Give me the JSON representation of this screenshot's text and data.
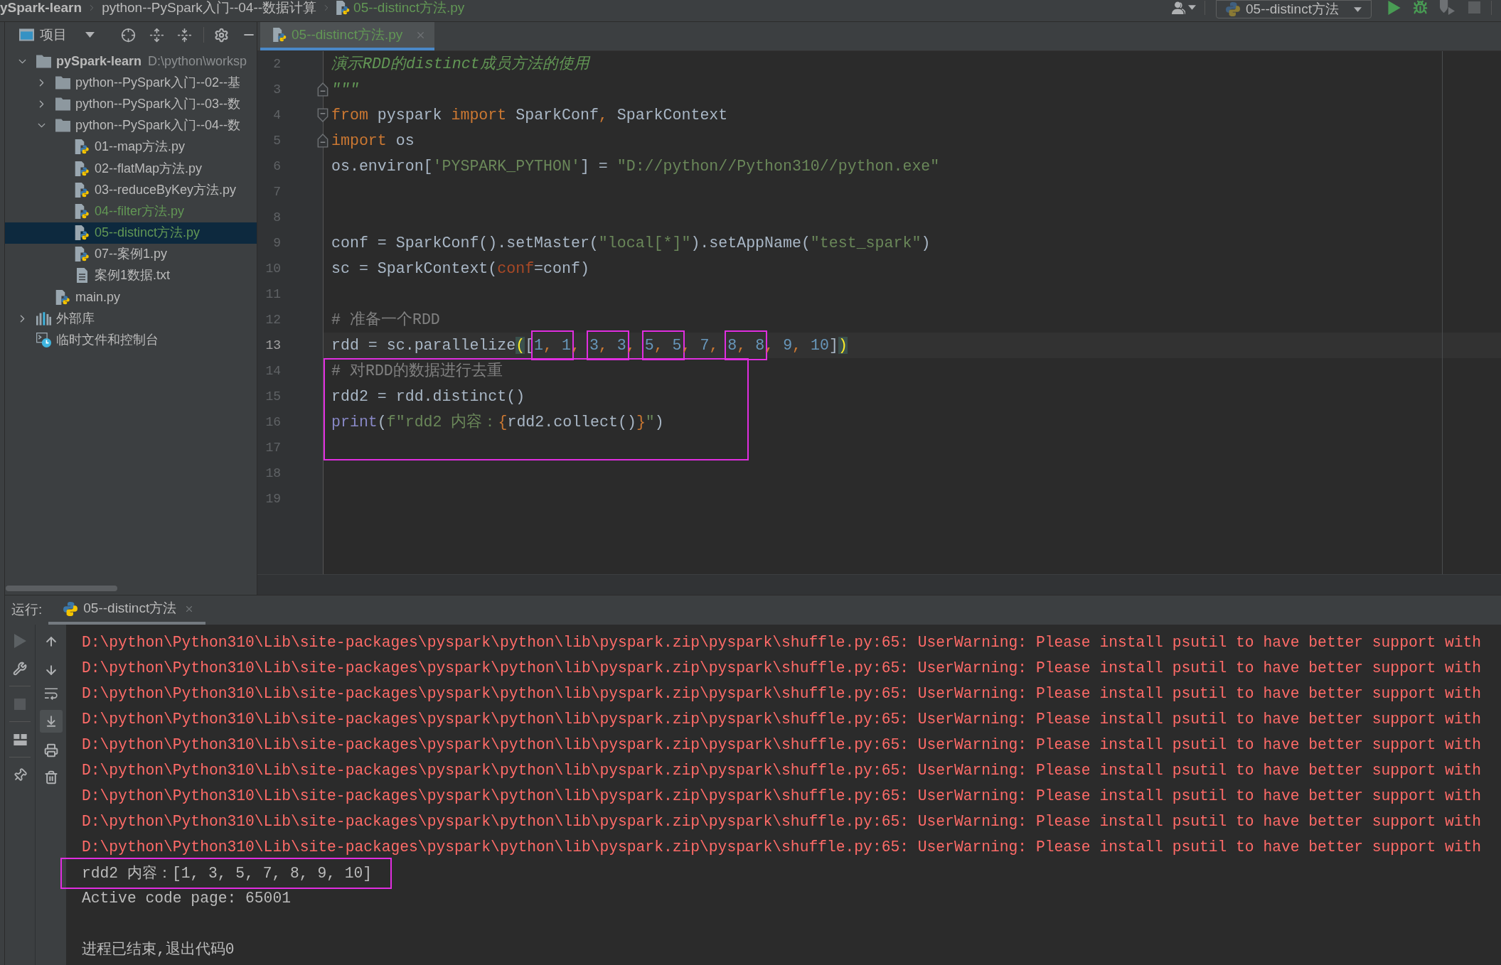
{
  "breadcrumb": [
    {
      "label": "ySpark-learn",
      "kind": "project",
      "changed": false
    },
    {
      "label": "python--PySpark入门--04--数据计算",
      "kind": "folder",
      "changed": false
    },
    {
      "label": "05--distinct方法.py",
      "kind": "python_file",
      "changed": true
    }
  ],
  "toolbar": {
    "run_config": "05--distinct方法",
    "run": {
      "disabled": false
    },
    "debug": {
      "disabled": false
    },
    "coverage": {
      "disabled": true
    },
    "stop": {
      "disabled": true
    }
  },
  "project_panel": {
    "title": "项目",
    "tree": [
      {
        "label": "pySpark-learn",
        "path": "D:\\python\\worksp",
        "kind": "project",
        "expanded": true,
        "selected": false,
        "changed": false,
        "children": [
          {
            "label": "python--PySpark入门--02--基",
            "kind": "folder",
            "expanded": false,
            "selected": false,
            "changed": false
          },
          {
            "label": "python--PySpark入门--03--数",
            "kind": "folder",
            "expanded": false,
            "selected": false,
            "changed": false
          },
          {
            "label": "python--PySpark入门--04--数",
            "kind": "folder",
            "expanded": true,
            "selected": false,
            "changed": false,
            "children": [
              {
                "label": "01--map方法.py",
                "kind": "python",
                "selected": false,
                "changed": false
              },
              {
                "label": "02--flatMap方法.py",
                "kind": "python",
                "selected": false,
                "changed": false
              },
              {
                "label": "03--reduceByKey方法.py",
                "kind": "python",
                "selected": false,
                "changed": false
              },
              {
                "label": "04--filter方法.py",
                "kind": "python",
                "selected": false,
                "changed": true
              },
              {
                "label": "05--distinct方法.py",
                "kind": "python",
                "selected": true,
                "changed": true
              },
              {
                "label": "07--案例1.py",
                "kind": "python",
                "selected": false,
                "changed": false
              },
              {
                "label": "案例1数据.txt",
                "kind": "text",
                "selected": false,
                "changed": false
              }
            ]
          },
          {
            "label": "main.py",
            "kind": "python",
            "selected": false,
            "changed": false
          }
        ]
      },
      {
        "label": "外部库",
        "kind": "library",
        "expanded": false,
        "selected": false,
        "changed": false
      },
      {
        "label": "临时文件和控制台",
        "kind": "scratches",
        "selected": false,
        "changed": false
      }
    ]
  },
  "editor": {
    "tabs": [
      {
        "label": "05--distinct方法.py",
        "selected": true,
        "changed": true
      }
    ],
    "lines": [
      {
        "number": "2",
        "current": false,
        "highlighted": false,
        "tokens": [
          {
            "text": "演示RDD的distinct成员方法的使用",
            "kind": "docstring"
          }
        ]
      },
      {
        "number": "3",
        "current": false,
        "highlighted": false,
        "fold": {
          "kind": "end"
        },
        "tokens": [
          {
            "text": "\"\"\"",
            "kind": "docstring"
          }
        ]
      },
      {
        "number": "4",
        "current": false,
        "highlighted": false,
        "fold": {
          "kind": "start"
        },
        "tokens": [
          {
            "text": "from",
            "kind": "keyword"
          },
          {
            "text": " pyspark ",
            "kind": "plain"
          },
          {
            "text": "import",
            "kind": "keyword"
          },
          {
            "text": " SparkConf",
            "kind": "plain"
          },
          {
            "text": ",",
            "kind": "separator"
          },
          {
            "text": " SparkContext",
            "kind": "plain"
          }
        ]
      },
      {
        "number": "5",
        "current": false,
        "highlighted": false,
        "fold": {
          "kind": "end"
        },
        "tokens": [
          {
            "text": "import",
            "kind": "keyword"
          },
          {
            "text": " os",
            "kind": "plain"
          }
        ]
      },
      {
        "number": "6",
        "current": false,
        "highlighted": false,
        "tokens": [
          {
            "text": "os.environ[",
            "kind": "plain"
          },
          {
            "text": "'PYSPARK_PYTHON'",
            "kind": "string"
          },
          {
            "text": "] = ",
            "kind": "plain"
          },
          {
            "text": "\"D://python//Python310//python.exe\"",
            "kind": "string"
          }
        ]
      },
      {
        "number": "7",
        "current": false,
        "highlighted": false
      },
      {
        "number": "8",
        "current": false,
        "highlighted": false
      },
      {
        "number": "9",
        "current": false,
        "highlighted": false,
        "tokens": [
          {
            "text": "conf = SparkConf().setMaster(",
            "kind": "plain"
          },
          {
            "text": "\"local[*]\"",
            "kind": "string"
          },
          {
            "text": ").setAppName(",
            "kind": "plain"
          },
          {
            "text": "\"test_spark\"",
            "kind": "string"
          },
          {
            "text": ")",
            "kind": "plain"
          }
        ]
      },
      {
        "number": "10",
        "current": false,
        "highlighted": false,
        "tokens": [
          {
            "text": "sc = SparkContext(",
            "kind": "plain"
          },
          {
            "text": "conf",
            "kind": "param"
          },
          {
            "text": "=conf)",
            "kind": "plain"
          }
        ]
      },
      {
        "number": "11",
        "current": false,
        "highlighted": false
      },
      {
        "number": "12",
        "current": false,
        "highlighted": false,
        "tokens": [
          {
            "text": "# 准备一个RDD",
            "kind": "comment"
          }
        ]
      },
      {
        "number": "13",
        "current": true,
        "highlighted": false,
        "tokens": [
          {
            "text": "rdd = sc.parallelize",
            "kind": "plain"
          },
          {
            "text": "(",
            "kind": "brace_match"
          },
          {
            "text": "[",
            "kind": "plain"
          },
          {
            "kind": "boxed",
            "tokens": [
              {
                "text": "1",
                "kind": "number"
              },
              {
                "text": ", ",
                "kind": "separator"
              },
              {
                "text": "1",
                "kind": "number"
              }
            ]
          },
          {
            "text": ", ",
            "kind": "separator"
          },
          {
            "kind": "boxed",
            "tokens": [
              {
                "text": "3",
                "kind": "number"
              },
              {
                "text": ", ",
                "kind": "separator"
              },
              {
                "text": "3",
                "kind": "number"
              }
            ]
          },
          {
            "text": ", ",
            "kind": "separator"
          },
          {
            "kind": "boxed",
            "tokens": [
              {
                "text": "5",
                "kind": "number"
              },
              {
                "text": ", ",
                "kind": "separator"
              },
              {
                "text": "5",
                "kind": "number"
              }
            ]
          },
          {
            "text": ", ",
            "kind": "separator"
          },
          {
            "text": "7",
            "kind": "number"
          },
          {
            "text": ", ",
            "kind": "separator"
          },
          {
            "kind": "boxed",
            "tokens": [
              {
                "text": "8",
                "kind": "number"
              },
              {
                "text": ", ",
                "kind": "separator"
              },
              {
                "text": "8",
                "kind": "number"
              }
            ]
          },
          {
            "text": ", ",
            "kind": "separator"
          },
          {
            "text": "9",
            "kind": "number"
          },
          {
            "text": ", ",
            "kind": "separator"
          },
          {
            "text": "10",
            "kind": "number"
          },
          {
            "text": "]",
            "kind": "plain"
          },
          {
            "text": ")",
            "kind": "brace_match"
          }
        ]
      },
      {
        "number": "14",
        "current": false,
        "highlighted": true,
        "tokens": [
          {
            "text": "# 对RDD的数据进行去重",
            "kind": "comment"
          }
        ]
      },
      {
        "number": "15",
        "current": false,
        "highlighted": true,
        "tokens": [
          {
            "text": "rdd2 = rdd.distinct()",
            "kind": "plain"
          }
        ]
      },
      {
        "number": "16",
        "current": false,
        "highlighted": true,
        "tokens": [
          {
            "text": "print",
            "kind": "builtin"
          },
          {
            "text": "(",
            "kind": "plain"
          },
          {
            "text": "f\"rdd2 内容：",
            "kind": "string"
          },
          {
            "text": "{",
            "kind": "separator"
          },
          {
            "text": "rdd2.collect()",
            "kind": "plain"
          },
          {
            "text": "}",
            "kind": "separator"
          },
          {
            "text": "\"",
            "kind": "string"
          },
          {
            "text": ")",
            "kind": "plain"
          }
        ]
      },
      {
        "number": "17",
        "current": false,
        "highlighted": true
      },
      {
        "number": "18",
        "current": false,
        "highlighted": false
      },
      {
        "number": "19",
        "current": false,
        "highlighted": false
      }
    ]
  },
  "run_panel": {
    "label": "运行:",
    "tabs": [
      {
        "label": "05--distinct方法",
        "selected": true
      }
    ],
    "tools": {
      "rerun": {
        "disabled": true
      },
      "stop": {
        "disabled": true
      },
      "soft_wrap": {
        "on": false
      },
      "scroll_to_end": {
        "on": true
      }
    },
    "output": [
      {
        "text": "D:\\python\\Python310\\Lib\\site-packages\\pyspark\\python\\lib\\pyspark.zip\\pyspark\\shuffle.py:65: UserWarning: Please install psutil to have better support with",
        "kind": "error",
        "highlighted": false
      },
      {
        "text": "D:\\python\\Python310\\Lib\\site-packages\\pyspark\\python\\lib\\pyspark.zip\\pyspark\\shuffle.py:65: UserWarning: Please install psutil to have better support with",
        "kind": "error",
        "highlighted": false
      },
      {
        "text": "D:\\python\\Python310\\Lib\\site-packages\\pyspark\\python\\lib\\pyspark.zip\\pyspark\\shuffle.py:65: UserWarning: Please install psutil to have better support with",
        "kind": "error",
        "highlighted": false
      },
      {
        "text": "D:\\python\\Python310\\Lib\\site-packages\\pyspark\\python\\lib\\pyspark.zip\\pyspark\\shuffle.py:65: UserWarning: Please install psutil to have better support with",
        "kind": "error",
        "highlighted": false
      },
      {
        "text": "D:\\python\\Python310\\Lib\\site-packages\\pyspark\\python\\lib\\pyspark.zip\\pyspark\\shuffle.py:65: UserWarning: Please install psutil to have better support with",
        "kind": "error",
        "highlighted": false
      },
      {
        "text": "D:\\python\\Python310\\Lib\\site-packages\\pyspark\\python\\lib\\pyspark.zip\\pyspark\\shuffle.py:65: UserWarning: Please install psutil to have better support with",
        "kind": "error",
        "highlighted": false
      },
      {
        "text": "D:\\python\\Python310\\Lib\\site-packages\\pyspark\\python\\lib\\pyspark.zip\\pyspark\\shuffle.py:65: UserWarning: Please install psutil to have better support with",
        "kind": "error",
        "highlighted": false
      },
      {
        "text": "D:\\python\\Python310\\Lib\\site-packages\\pyspark\\python\\lib\\pyspark.zip\\pyspark\\shuffle.py:65: UserWarning: Please install psutil to have better support with",
        "kind": "error",
        "highlighted": false
      },
      {
        "text": "D:\\python\\Python310\\Lib\\site-packages\\pyspark\\python\\lib\\pyspark.zip\\pyspark\\shuffle.py:65: UserWarning: Please install psutil to have better support with",
        "kind": "error",
        "highlighted": false
      },
      {
        "text": "rdd2 内容：[1, 3, 5, 7, 8, 9, 10]",
        "kind": "output",
        "highlighted": true
      },
      {
        "text": "Active code page: 65001",
        "kind": "output",
        "highlighted": false
      },
      {
        "text": "进程已结束,退出代码0",
        "kind": "status",
        "highlighted": false
      }
    ]
  }
}
